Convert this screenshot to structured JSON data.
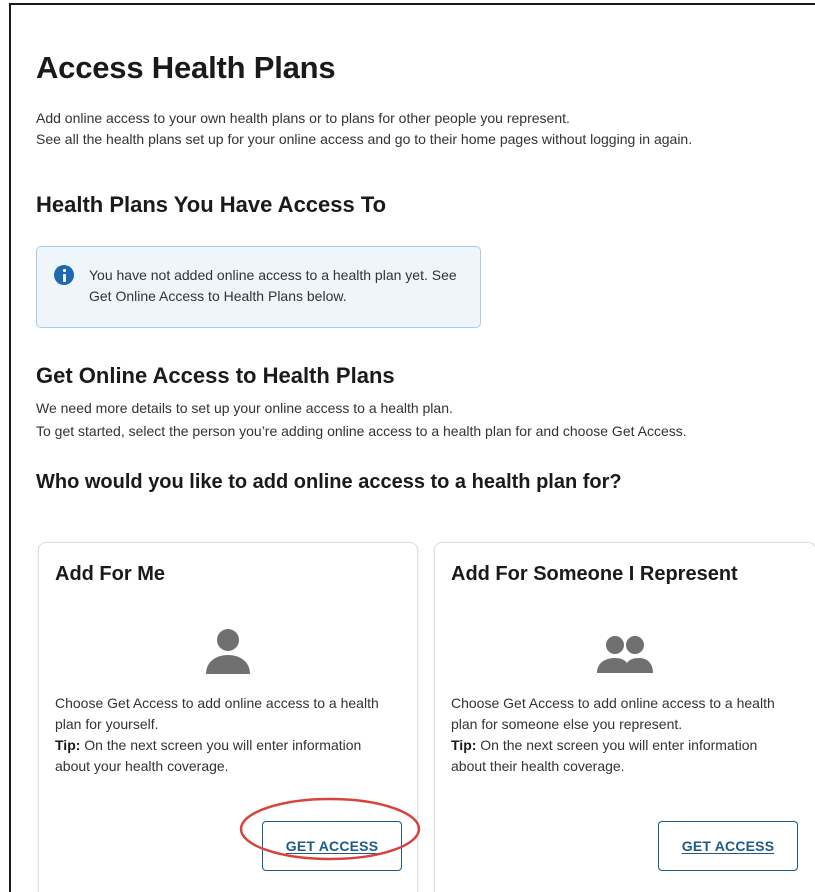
{
  "page": {
    "title": "Access Health Plans",
    "intro_lines": [
      "Add online access to your own health plans or to plans for other people you represent.",
      "See all the health plans set up for your online access and go to their home pages without logging in again."
    ]
  },
  "access_section": {
    "heading": "Health Plans You Have Access To",
    "info_icon": "info-circle-icon",
    "info_message": "You have not added online access to a health plan yet. See Get Online Access to Health Plans below."
  },
  "get_section": {
    "heading": "Get Online Access to Health Plans",
    "description_lines": [
      "We need more details to set up your online access to a health plan.",
      "To get started, select the person you’re adding online access to a health plan for and choose Get Access."
    ],
    "question": "Who would you like to add online access to a health plan for?"
  },
  "cards": [
    {
      "title": "Add For Me",
      "icon": "person-icon",
      "description": "Choose Get Access to add online access to a health plan for yourself.",
      "tip_label": "Tip:",
      "tip_text": " On the next screen you will enter information about your health coverage.",
      "button_label": "GET ACCESS"
    },
    {
      "title": "Add For Someone I Represent",
      "icon": "people-icon",
      "description": "Choose Get Access to add online access to a health plan for someone else you represent.",
      "tip_label": "Tip:",
      "tip_text": " On the next screen you will enter information about their health coverage.",
      "button_label": "GET ACCESS"
    }
  ],
  "colors": {
    "accent": "#1d5a8a",
    "info_icon": "#1d6ab0",
    "info_background": "#eef6fc",
    "info_border": "#a9cde8",
    "icon_gray": "#707070",
    "annotation_red": "#d9433b"
  }
}
